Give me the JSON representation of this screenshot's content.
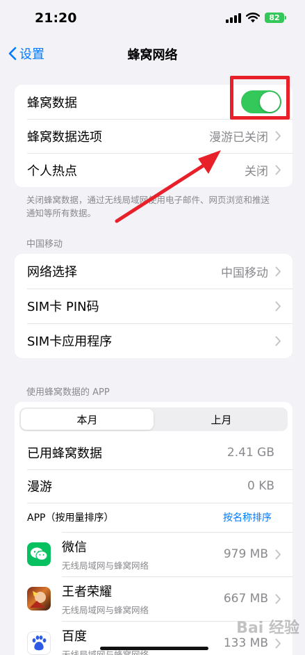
{
  "status_bar": {
    "time": "21:20",
    "battery": "82"
  },
  "nav": {
    "back_label": "设置",
    "title": "蜂窝网络"
  },
  "main_group": {
    "cellular_data_label": "蜂窝数据",
    "cellular_data_on": true,
    "options_label": "蜂窝数据选项",
    "options_value": "漫游已关闭",
    "hotspot_label": "个人热点",
    "hotspot_value": "关闭"
  },
  "footnote": "关闭蜂窝数据，通过无线局域网使用电子邮件、网页浏览和推送通知等所有数据。",
  "carrier": {
    "header": "中国移动",
    "network_label": "网络选择",
    "network_value": "中国移动",
    "sim_pin_label": "SIM卡 PIN码",
    "sim_apps_label": "SIM卡应用程序"
  },
  "usage": {
    "header": "使用蜂窝数据的 APP",
    "tabs": [
      "本月",
      "上月"
    ],
    "used_label": "已用蜂窝数据",
    "used_value": "2.41 GB",
    "roaming_label": "漫游",
    "roaming_value": "0 KB",
    "list_header": "APP（按用量排序）",
    "sort_link": "按名称排序",
    "apps": [
      {
        "name": "微信",
        "sub": "无线局域网与蜂窝网络",
        "value": "979 MB",
        "icon": "wechat-icon"
      },
      {
        "name": "王者荣耀",
        "sub": "无线局域网与蜂窝网络",
        "value": "667 MB",
        "icon": "game-icon"
      },
      {
        "name": "百度",
        "sub": "无线局域网与蜂窝网络",
        "value": "133 MB",
        "icon": "baidu-icon"
      }
    ]
  },
  "watermark": "Bai 经验",
  "colors": {
    "accent": "#007aff",
    "toggle_on": "#34c759",
    "highlight": "#e8202a"
  }
}
